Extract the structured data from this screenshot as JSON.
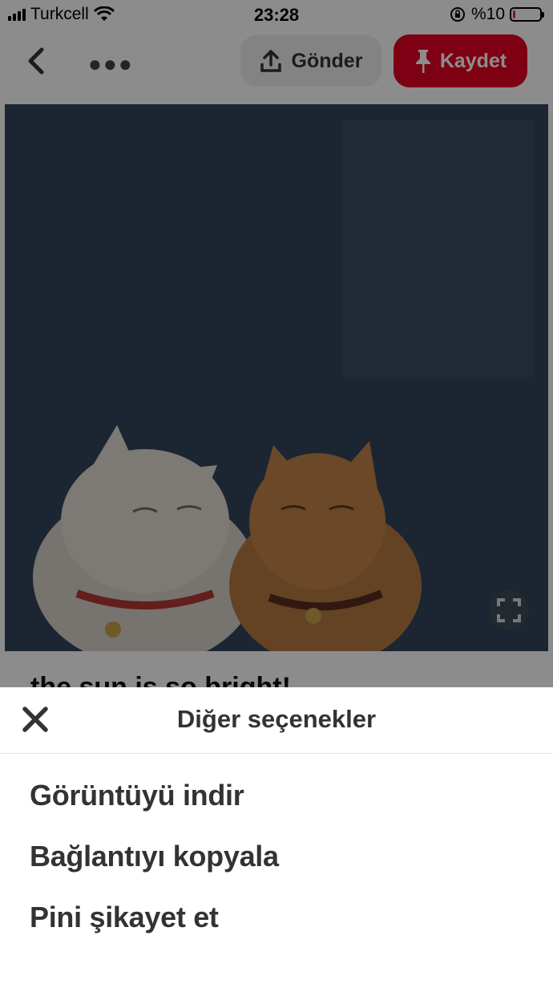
{
  "status_bar": {
    "carrier": "Turkcell",
    "time": "23:28",
    "battery_percent": "%10",
    "battery_level": 0.1
  },
  "nav": {
    "send_label": "Gönder",
    "save_label": "Kaydet"
  },
  "pin": {
    "title": "the sun is so bright!"
  },
  "sheet": {
    "title": "Diğer seçenekler",
    "items": [
      {
        "label": "Görüntüyü indir"
      },
      {
        "label": "Bağlantıyı kopyala"
      },
      {
        "label": "Pini şikayet et"
      }
    ]
  },
  "colors": {
    "save_red": "#e60023",
    "image_bg": "#33455c",
    "sheet_text": "#333333"
  },
  "icons": [
    "signal-icon",
    "wifi-icon",
    "rotation-lock-icon",
    "battery-icon",
    "back-icon",
    "more-icon",
    "upload-icon",
    "pin-icon",
    "expand-icon",
    "close-icon"
  ]
}
